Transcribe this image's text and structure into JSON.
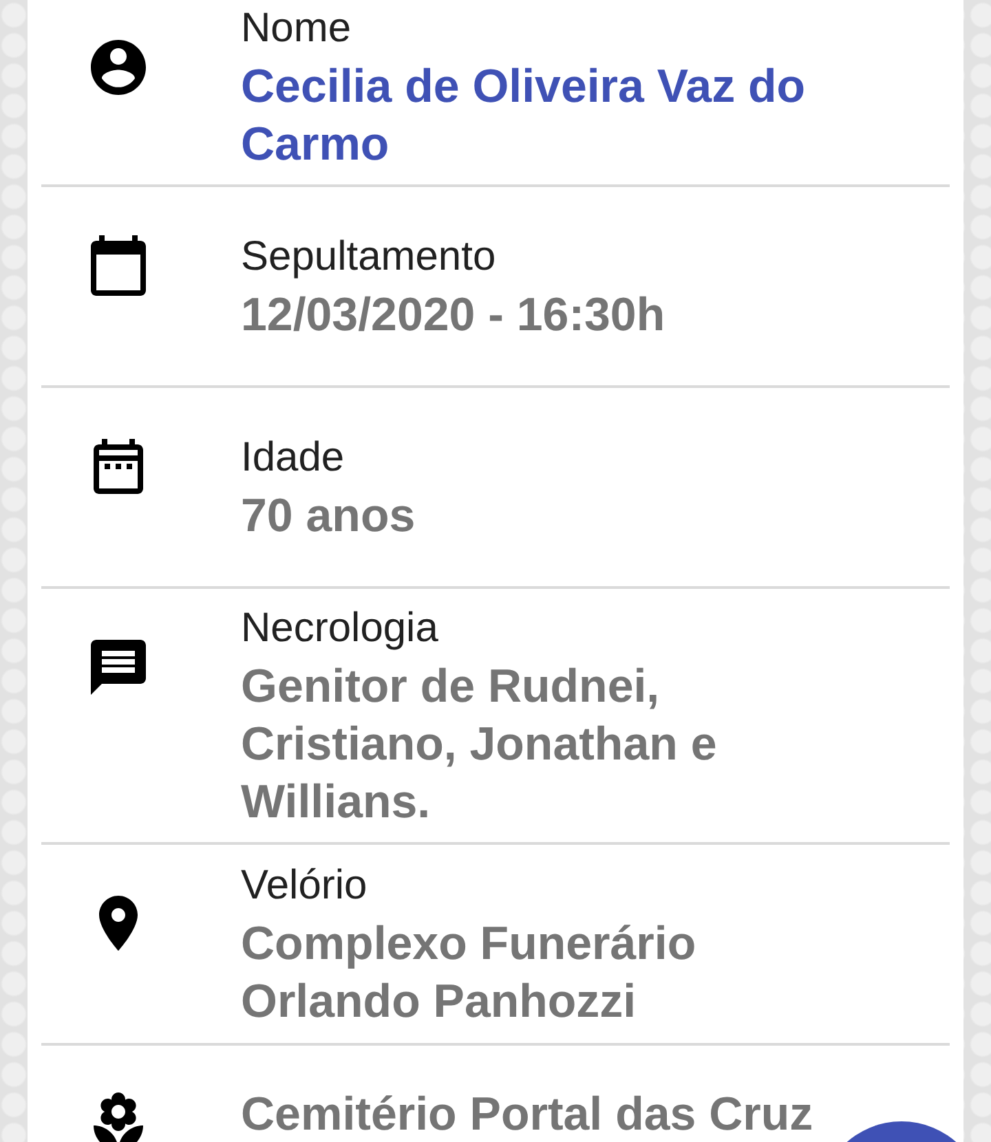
{
  "rows": [
    {
      "kind": "name",
      "label": "Nome",
      "value": "Cecilia de Oliveira Vaz do Carmo"
    },
    {
      "kind": "burial",
      "label": "Sepultamento",
      "value": "12/03/2020 - 16:30h"
    },
    {
      "kind": "age",
      "label": "Idade",
      "value": "70 anos"
    },
    {
      "kind": "obituary",
      "label": "Necrologia",
      "value": "Genitor de Rudnei, Cristiano, Jonathan e Willians."
    },
    {
      "kind": "wake",
      "label": "Velório",
      "value": "Complexo Funerário Orlando Panhozzi"
    },
    {
      "kind": "cemetery",
      "value": "Cemitério Portal das Cruz"
    }
  ]
}
